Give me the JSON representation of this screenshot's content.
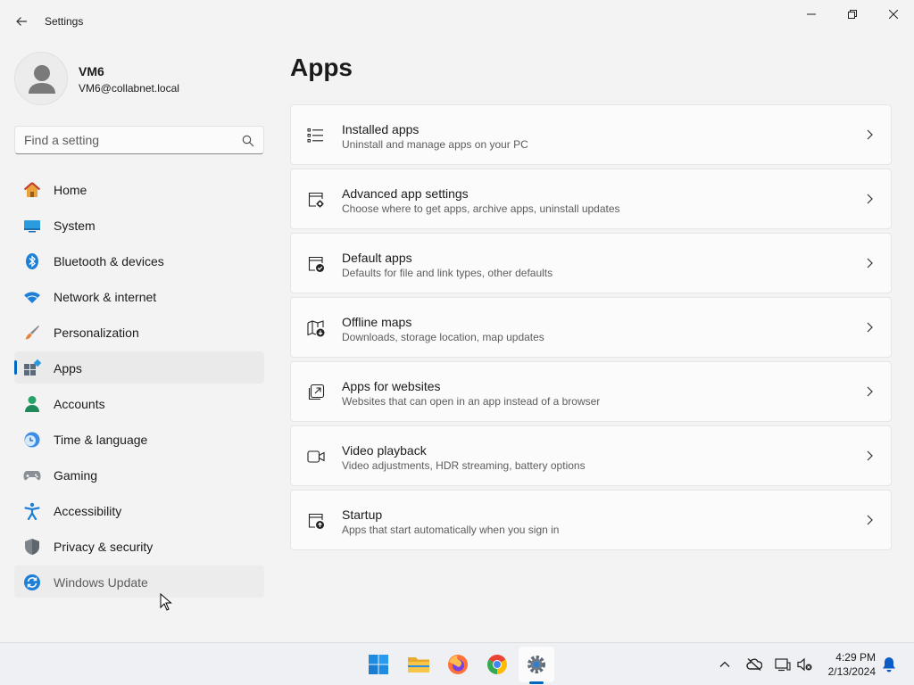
{
  "window": {
    "title": "Settings"
  },
  "profile": {
    "name": "VM6",
    "email": "VM6@collabnet.local"
  },
  "search": {
    "placeholder": "Find a setting"
  },
  "nav": {
    "items": [
      {
        "label": "Home",
        "icon": "home-icon"
      },
      {
        "label": "System",
        "icon": "system-icon"
      },
      {
        "label": "Bluetooth & devices",
        "icon": "bluetooth-icon"
      },
      {
        "label": "Network & internet",
        "icon": "wifi-icon"
      },
      {
        "label": "Personalization",
        "icon": "brush-icon"
      },
      {
        "label": "Apps",
        "icon": "apps-icon",
        "selected": true
      },
      {
        "label": "Accounts",
        "icon": "person-icon"
      },
      {
        "label": "Time & language",
        "icon": "clock-globe-icon"
      },
      {
        "label": "Gaming",
        "icon": "gamepad-icon"
      },
      {
        "label": "Accessibility",
        "icon": "accessibility-icon"
      },
      {
        "label": "Privacy & security",
        "icon": "shield-icon"
      },
      {
        "label": "Windows Update",
        "icon": "update-icon"
      }
    ]
  },
  "main": {
    "title": "Apps",
    "cards": [
      {
        "title": "Installed apps",
        "description": "Uninstall and manage apps on your PC",
        "icon": "list-icon"
      },
      {
        "title": "Advanced app settings",
        "description": "Choose where to get apps, archive apps, uninstall updates",
        "icon": "app-gear-icon"
      },
      {
        "title": "Default apps",
        "description": "Defaults for file and link types, other defaults",
        "icon": "app-check-icon"
      },
      {
        "title": "Offline maps",
        "description": "Downloads, storage location, map updates",
        "icon": "map-download-icon"
      },
      {
        "title": "Apps for websites",
        "description": "Websites that can open in an app instead of a browser",
        "icon": "open-in-app-icon"
      },
      {
        "title": "Video playback",
        "description": "Video adjustments, HDR streaming, battery options",
        "icon": "video-icon"
      },
      {
        "title": "Startup",
        "description": "Apps that start automatically when you sign in",
        "icon": "startup-icon"
      }
    ]
  },
  "taskbar": {
    "apps": [
      "start-icon",
      "file-explorer-icon",
      "firefox-icon",
      "chrome-icon",
      "settings-icon"
    ],
    "clock": {
      "time": "4:29 PM",
      "date": "2/13/2024"
    }
  },
  "colors": {
    "accent": "#0067c0",
    "background": "#f3f3f3",
    "card": "#fbfbfb"
  }
}
